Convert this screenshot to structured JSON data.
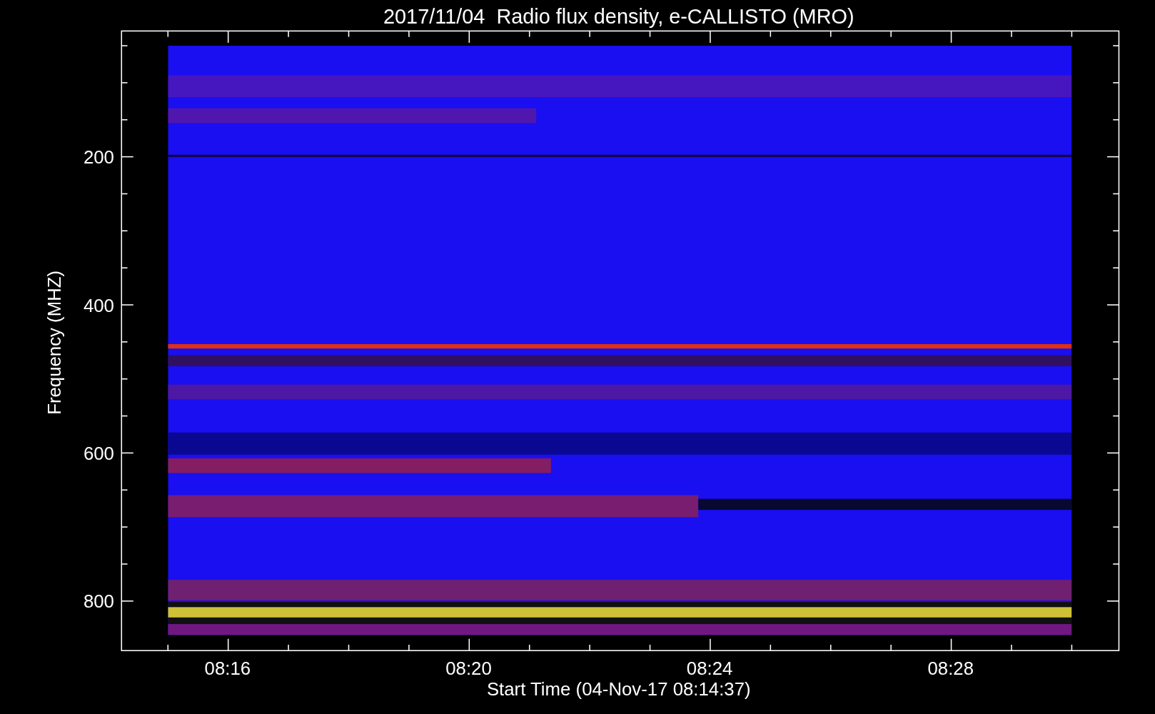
{
  "title": "2017/11/04  Radio flux density, e-CALLISTO (MRO)",
  "y_axis": {
    "label": "Frequency (MHZ)",
    "ticks": [
      "200",
      "400",
      "600",
      "800"
    ]
  },
  "x_axis": {
    "label": "Start Time (04-Nov-17 08:14:37)",
    "ticks": [
      "08:16",
      "08:20",
      "08:24",
      "08:28"
    ]
  }
}
